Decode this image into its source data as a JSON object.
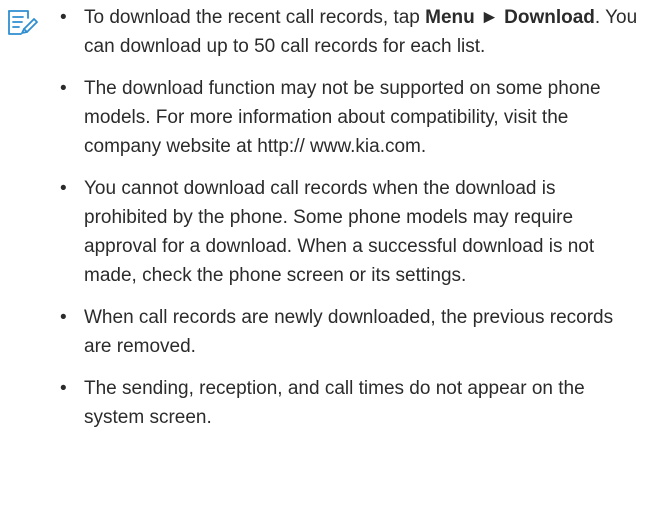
{
  "note": {
    "icon": "note-pencil-icon",
    "bullet_char": "•",
    "item1": {
      "lead": "To download the recent call records, tap ",
      "menu": "Menu",
      "arrow": " ► ",
      "download": "Download",
      "rest": ". You can download up to 50 call records for each list."
    },
    "item2": "The download function may not be supported on some phone models. For more information about compatibility, visit the company website at http:// www.kia.com.",
    "item3": "You cannot download call records when the download is prohibited by the phone. Some phone models may require approval for a download. When a successful download is not made, check the phone screen or its settings.",
    "item4": "When call records are newly downloaded, the previous records are removed.",
    "item5": "The sending, reception, and call times do not appear on the system screen."
  }
}
